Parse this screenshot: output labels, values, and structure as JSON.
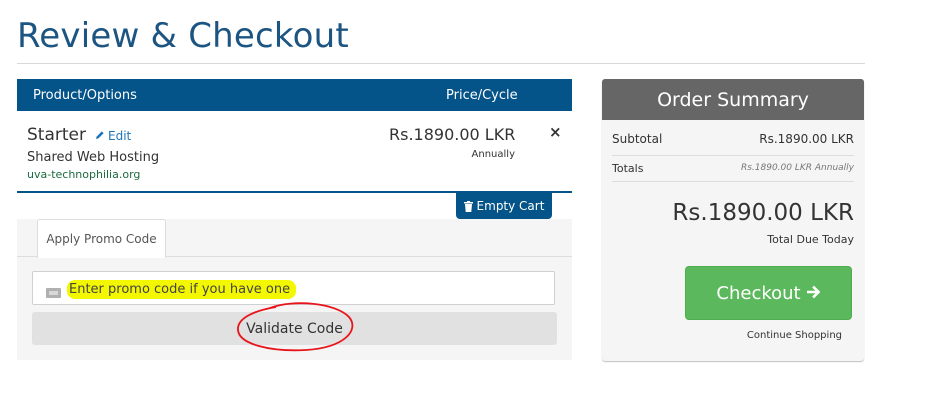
{
  "page": {
    "title": "Review & Checkout"
  },
  "cart": {
    "col_product": "Product/Options",
    "col_price": "Price/Cycle",
    "item": {
      "name": "Starter",
      "edit_label": "Edit",
      "group": "Shared Web Hosting",
      "domain": "uva-technophilia.org",
      "price": "Rs.1890.00 LKR",
      "cycle": "Annually",
      "remove_symbol": "×"
    },
    "empty_cart_label": "Empty Cart"
  },
  "promo": {
    "tab_label": "Apply Promo Code",
    "input_placeholder": "Enter promo code if you have one",
    "input_value": "",
    "validate_label": "Validate Code",
    "highlight_color": "#f3f700",
    "annotation_color": "#e8141c"
  },
  "summary": {
    "heading": "Order Summary",
    "subtotal_label": "Subtotal",
    "subtotal_value": "Rs.1890.00 LKR",
    "totals_label": "Totals",
    "totals_value": "Rs.1890.00 LKR Annually",
    "total_due": "Rs.1890.00 LKR",
    "total_due_label": "Total Due Today",
    "checkout_label": "Checkout",
    "continue_label": "Continue Shopping"
  },
  "colors": {
    "primary": "#045389",
    "title": "#1c5582",
    "summary_header": "#666666",
    "checkout": "#5cb85c"
  },
  "icons": [
    "pencil-icon",
    "close-icon",
    "trash-icon",
    "ticket-icon",
    "arrow-right-icon"
  ]
}
